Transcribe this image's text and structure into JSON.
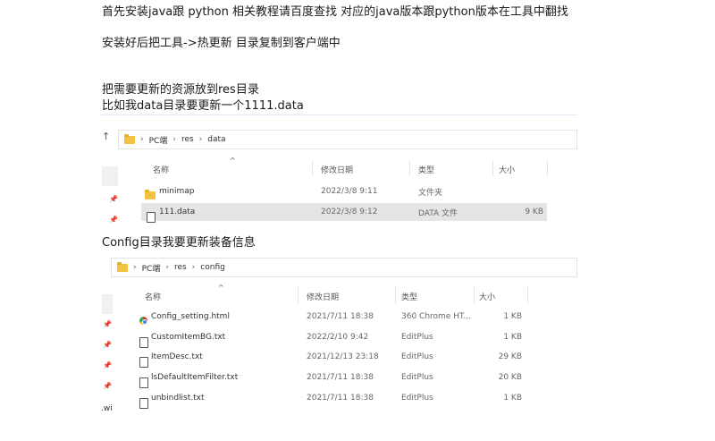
{
  "doc": {
    "line1": "首先安装java跟 python 相关教程请百度查找 对应的java版本跟python版本在工具中翻找",
    "line2": "安装好后把工具->热更新 目录复制到客户端中",
    "line3": "把需要更新的资源放到res目录",
    "line4": "比如我data目录要更新一个1111.data",
    "line5": "Config目录我要更新装备信息"
  },
  "explorer1": {
    "breadcrumb": [
      "PC端",
      "res",
      "data"
    ],
    "up_arrow": "↑",
    "columns": {
      "name": "名称",
      "modified": "修改日期",
      "type": "类型",
      "size": "大小"
    },
    "sort_indicator": "^",
    "rows": [
      {
        "name": "minimap",
        "modified": "2022/3/8 9:11",
        "type": "文件夹",
        "size": "",
        "icon": "folder-icon"
      },
      {
        "name": "111.data",
        "modified": "2022/3/8 9:12",
        "type": "DATA 文件",
        "size": "9 KB",
        "icon": "file-icon"
      }
    ]
  },
  "explorer2": {
    "breadcrumb": [
      "PC端",
      "res",
      "config"
    ],
    "columns": {
      "name": "名称",
      "modified": "修改日期",
      "type": "类型",
      "size": "大小"
    },
    "sort_indicator": "^",
    "side_text": ".wi",
    "rows": [
      {
        "name": "Config_setting.html",
        "modified": "2021/7/11 18:38",
        "type": "360 Chrome HT...",
        "size": "1 KB",
        "icon": "chrome-icon"
      },
      {
        "name": "CustomItemBG.txt",
        "modified": "2022/2/10 9:42",
        "type": "EditPlus",
        "size": "1 KB",
        "icon": "file-icon"
      },
      {
        "name": "ItemDesc.txt",
        "modified": "2021/12/13 23:18",
        "type": "EditPlus",
        "size": "29 KB",
        "icon": "file-icon"
      },
      {
        "name": "lsDefaultItemFilter.txt",
        "modified": "2021/7/11 18:38",
        "type": "EditPlus",
        "size": "20 KB",
        "icon": "file-icon"
      },
      {
        "name": "unbindlist.txt",
        "modified": "2021/7/11 18:38",
        "type": "EditPlus",
        "size": "1 KB",
        "icon": "file-icon"
      }
    ]
  }
}
